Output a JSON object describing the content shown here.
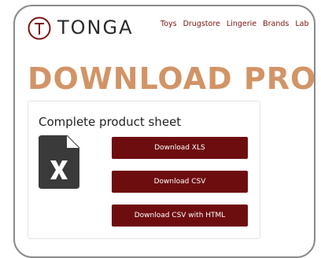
{
  "brand": {
    "name": "TONGA",
    "accent_color": "#7a1414"
  },
  "nav": {
    "items": [
      {
        "label": "Toys"
      },
      {
        "label": "Drugstore"
      },
      {
        "label": "Lingerie"
      },
      {
        "label": "Brands"
      },
      {
        "label": "Lab"
      }
    ]
  },
  "page": {
    "title": "DOWNLOAD PROD",
    "title_color": "#d29466"
  },
  "product_sheet": {
    "heading": "Complete product sheet",
    "file_icon": "excel-file-icon",
    "buttons": {
      "xls": "Download XLS",
      "csv": "Download CSV",
      "csv_html": "Download CSV with HTML"
    },
    "button_color": "#6e0d10"
  }
}
